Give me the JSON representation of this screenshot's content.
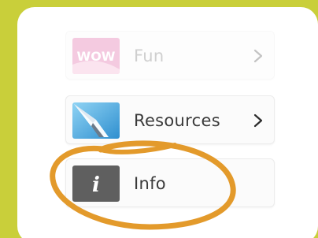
{
  "menu": {
    "items": [
      {
        "label": "Fun",
        "icon": "wow-logo-icon",
        "thumb_text": "WOW"
      },
      {
        "label": "Resources",
        "icon": "resources-book-icon"
      },
      {
        "label": "Info",
        "icon": "info-icon",
        "glyph": "i"
      }
    ]
  },
  "colors": {
    "background": "#c9cf3a",
    "panel": "#ffffff",
    "highlight_circle": "#e39a2b",
    "info_tile": "#5f5f5f",
    "resources_tile": "#3aa3d9",
    "fun_tile": "#e06aa7"
  }
}
